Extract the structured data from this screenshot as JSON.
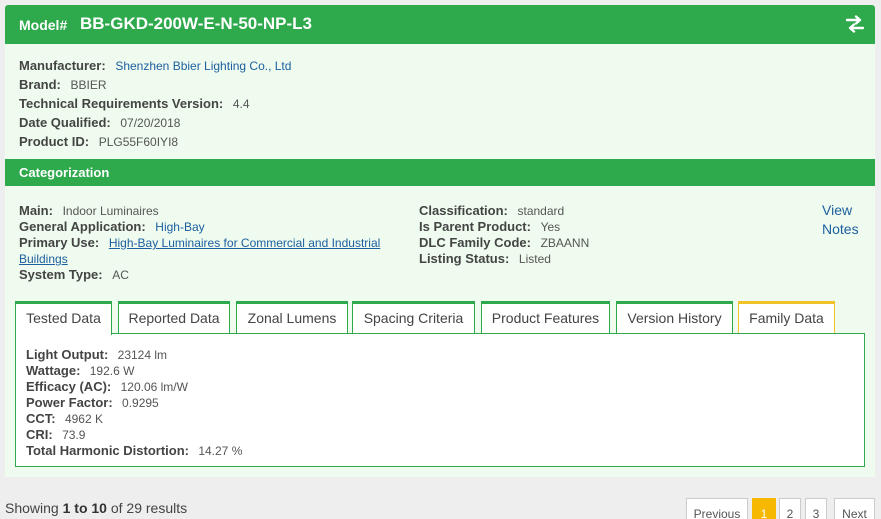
{
  "model": {
    "label": "Model#",
    "value": "BB-GKD-200W-E-N-50-NP-L3",
    "swap_icon": "swap-arrows-icon"
  },
  "product": {
    "manufacturer": {
      "label": "Manufacturer:",
      "value": "Shenzhen Bbier Lighting Co., Ltd"
    },
    "brand": {
      "label": "Brand:",
      "value": "BBIER"
    },
    "tech_version": {
      "label": "Technical Requirements Version:",
      "value": "4.4"
    },
    "date_qualified": {
      "label": "Date Qualified:",
      "value": "07/20/2018"
    },
    "product_id": {
      "label": "Product ID:",
      "value": "PLG55F60IYI8"
    }
  },
  "categorization": {
    "title": "Categorization",
    "main": {
      "label": "Main:",
      "value": "Indoor Luminaires"
    },
    "general_application": {
      "label": "General Application:",
      "value": "High-Bay"
    },
    "primary_use": {
      "label": "Primary Use:",
      "value_line1": "High-Bay Luminaires for Commercial and Industrial",
      "value_line2": "Buildings"
    },
    "system_type": {
      "label": "System Type:",
      "value": "AC"
    },
    "classification": {
      "label": "Classification:",
      "value": "standard"
    },
    "is_parent": {
      "label": "Is Parent Product:",
      "value": "Yes"
    },
    "family_code": {
      "label": "DLC Family Code:",
      "value": "ZBAANN"
    },
    "listing_status": {
      "label": "Listing Status:",
      "value": "Listed"
    },
    "view_notes_line1": "View",
    "view_notes_line2": "Notes"
  },
  "tabs": [
    {
      "label": "Tested Data",
      "active": true
    },
    {
      "label": "Reported Data"
    },
    {
      "label": "Zonal Lumens"
    },
    {
      "label": "Spacing Criteria"
    },
    {
      "label": "Product Features"
    },
    {
      "label": "Version History"
    },
    {
      "label": "Family Data",
      "accent": "#f2c22a"
    }
  ],
  "tested_data": {
    "light_output": {
      "label": "Light Output:",
      "value": "23124 lm"
    },
    "wattage": {
      "label": "Wattage:",
      "value": "192.6 W"
    },
    "efficacy": {
      "label": "Efficacy (AC):",
      "value": "120.06 lm/W"
    },
    "power_factor": {
      "label": "Power Factor:",
      "value": "0.9295"
    },
    "cct": {
      "label": "CCT:",
      "value": "4962 K"
    },
    "cri": {
      "label": "CRI:",
      "value": "73.9"
    },
    "thd": {
      "label": "Total Harmonic Distortion:",
      "value": "14.27 %"
    }
  },
  "results": {
    "prefix": "Showing",
    "from": "1",
    "to_word": "to",
    "to": "10",
    "of_text": "of 29 results"
  },
  "pagination": {
    "previous": "Previous",
    "pages": [
      "1",
      "2",
      "3"
    ],
    "next": "Next",
    "current": "1"
  },
  "colors": {
    "brand_green": "#2ea94c",
    "card_bg": "#eefbee",
    "link": "#1d5fa0",
    "active_page": "#f6b800"
  }
}
